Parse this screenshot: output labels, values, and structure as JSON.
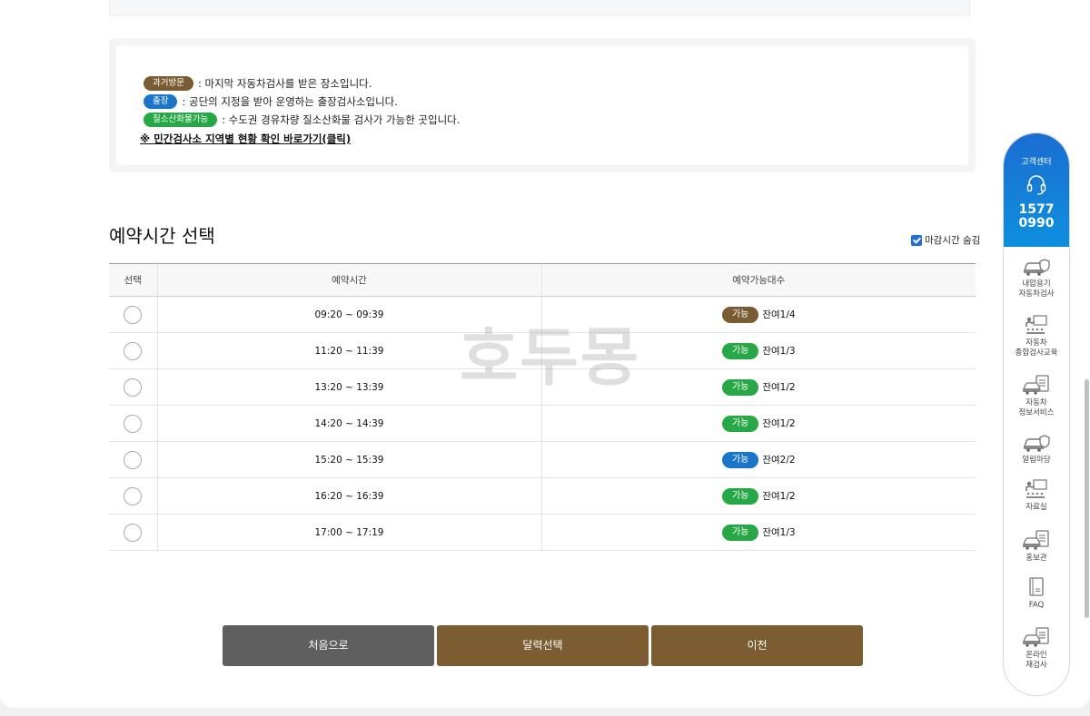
{
  "legend": {
    "items": [
      {
        "badge": "과거방문",
        "color": "#7a5c33",
        "text": ": 마지막 자동차검사를 받은 장소입니다."
      },
      {
        "badge": "출장",
        "color": "#1a76c9",
        "text": ": 공단의 지정을 받아 운영하는 출장검사소입니다."
      },
      {
        "badge": "질소산화물가능",
        "color": "#27a745",
        "text": ": 수도권 경유차량 질소산화물 검사가 가능한 곳입니다."
      }
    ],
    "link": "※ 민간검사소 지역별 현황 확인 바로가기(클릭)"
  },
  "section": {
    "title": "예약시간 선택",
    "hide_label": "마감시간 숨김"
  },
  "table": {
    "headers": [
      "선택",
      "예약시간",
      "예약가능대수"
    ],
    "rows": [
      {
        "time": "09:20 ~ 09:39",
        "status": "가능",
        "status_color": "#7a5c33",
        "remaining": "잔여1/4"
      },
      {
        "time": "11:20 ~ 11:39",
        "status": "가능",
        "status_color": "#27a745",
        "remaining": "잔여1/3"
      },
      {
        "time": "13:20 ~ 13:39",
        "status": "가능",
        "status_color": "#27a745",
        "remaining": "잔여1/2"
      },
      {
        "time": "14:20 ~ 14:39",
        "status": "가능",
        "status_color": "#27a745",
        "remaining": "잔여1/2"
      },
      {
        "time": "15:20 ~ 15:39",
        "status": "가능",
        "status_color": "#1a76c9",
        "remaining": "잔여2/2"
      },
      {
        "time": "16:20 ~ 16:39",
        "status": "가능",
        "status_color": "#27a745",
        "remaining": "잔여1/2"
      },
      {
        "time": "17:00 ~ 17:19",
        "status": "가능",
        "status_color": "#27a745",
        "remaining": "잔여1/3"
      }
    ]
  },
  "watermark": "호두몽",
  "buttons": {
    "first": "처음으로",
    "calendar": "달력선택",
    "prev": "이전"
  },
  "sidebar": {
    "cs_label": "고객센터",
    "phone_line1": "1577",
    "phone_line2": "0990",
    "items": [
      {
        "icon": "car-shield-icon",
        "line1": "내압용기",
        "line2": "자동차검사"
      },
      {
        "icon": "classroom-icon",
        "line1": "자동차",
        "line2": "종합검사교육"
      },
      {
        "icon": "car-document-icon",
        "line1": "자동차",
        "line2": "정보서비스"
      },
      {
        "icon": "car-shield-icon",
        "line1": "알림마당",
        "line2": ""
      },
      {
        "icon": "classroom-icon",
        "line1": "자료실",
        "line2": ""
      },
      {
        "icon": "car-document-icon",
        "line1": "홍보관",
        "line2": ""
      },
      {
        "icon": "notebook-icon",
        "line1": "FAQ",
        "line2": ""
      },
      {
        "icon": "car-document-icon",
        "line1": "온라인",
        "line2": "재검사"
      }
    ]
  }
}
